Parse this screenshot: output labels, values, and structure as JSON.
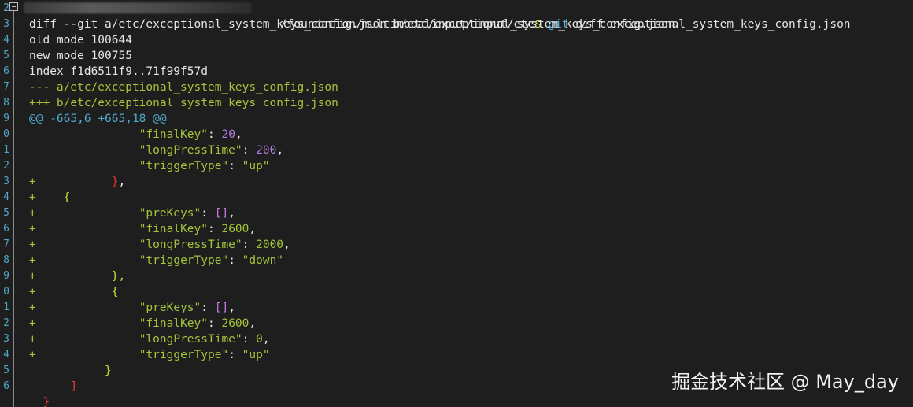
{
  "terminal": {
    "gutter_numbers": [
      "2",
      "3",
      "4",
      "5",
      "6",
      "7",
      "8",
      "9",
      "0",
      "1",
      "2",
      "3",
      "4",
      "5",
      "6",
      "7",
      "8",
      "9",
      "0",
      "1",
      "2",
      "3",
      "4",
      "5",
      "6"
    ],
    "prompt": {
      "path": "/foundation/multimodalinput/input/etc",
      "dollar": "$",
      "cmd_git": "git",
      "cmd_rest": " diff exceptional_system_keys_config.json"
    },
    "diff_header": {
      "diff_git": "diff --git a/etc/exceptional_system_keys_config.json b/etc/exceptional_system_keys_config.json",
      "old_mode": "old mode 100644",
      "new_mode": "new mode 100755",
      "index": "index f1d6511f9..71f99f57d",
      "minus_file": "--- a/etc/exceptional_system_keys_config.json",
      "plus_file": "+++ b/etc/exceptional_system_keys_config.json",
      "hunk": "@@ -665,6 +665,18 @@"
    },
    "context": {
      "final_key_name": "\"finalKey\"",
      "final_key_value": "20",
      "long_press_name": "\"longPressTime\"",
      "long_press_value": "200",
      "trigger_name": "\"triggerType\"",
      "trigger_value": "\"up\""
    },
    "added_1": {
      "prekeys_name": "\"preKeys\"",
      "prekeys_value": "[]",
      "final_key_name": "\"finalKey\"",
      "final_key_value": "2600",
      "long_press_name": "\"longPressTime\"",
      "long_press_value": "2000",
      "trigger_name": "\"triggerType\"",
      "trigger_value": "\"down\""
    },
    "added_2": {
      "prekeys_name": "\"preKeys\"",
      "prekeys_value": "[]",
      "final_key_name": "\"finalKey\"",
      "final_key_value": "2600",
      "long_press_name": "\"longPressTime\"",
      "long_press_value": "0",
      "trigger_name": "\"triggerType\"",
      "trigger_value": "\"up\""
    },
    "symbols": {
      "plus": "+",
      "open_brace": "{",
      "close_brace": "}",
      "close_brace_comma": "},",
      "close_bracket": "]",
      "colon": ": ",
      "comma": ","
    }
  },
  "watermark": "掘金技术社区 @ May_day",
  "colors": {
    "background": "#1e1e1e",
    "green": "#a6c43b",
    "blue": "#4fa7c9",
    "purple": "#b07fe0",
    "red": "#e53935",
    "yellow": "#e8e24a"
  }
}
